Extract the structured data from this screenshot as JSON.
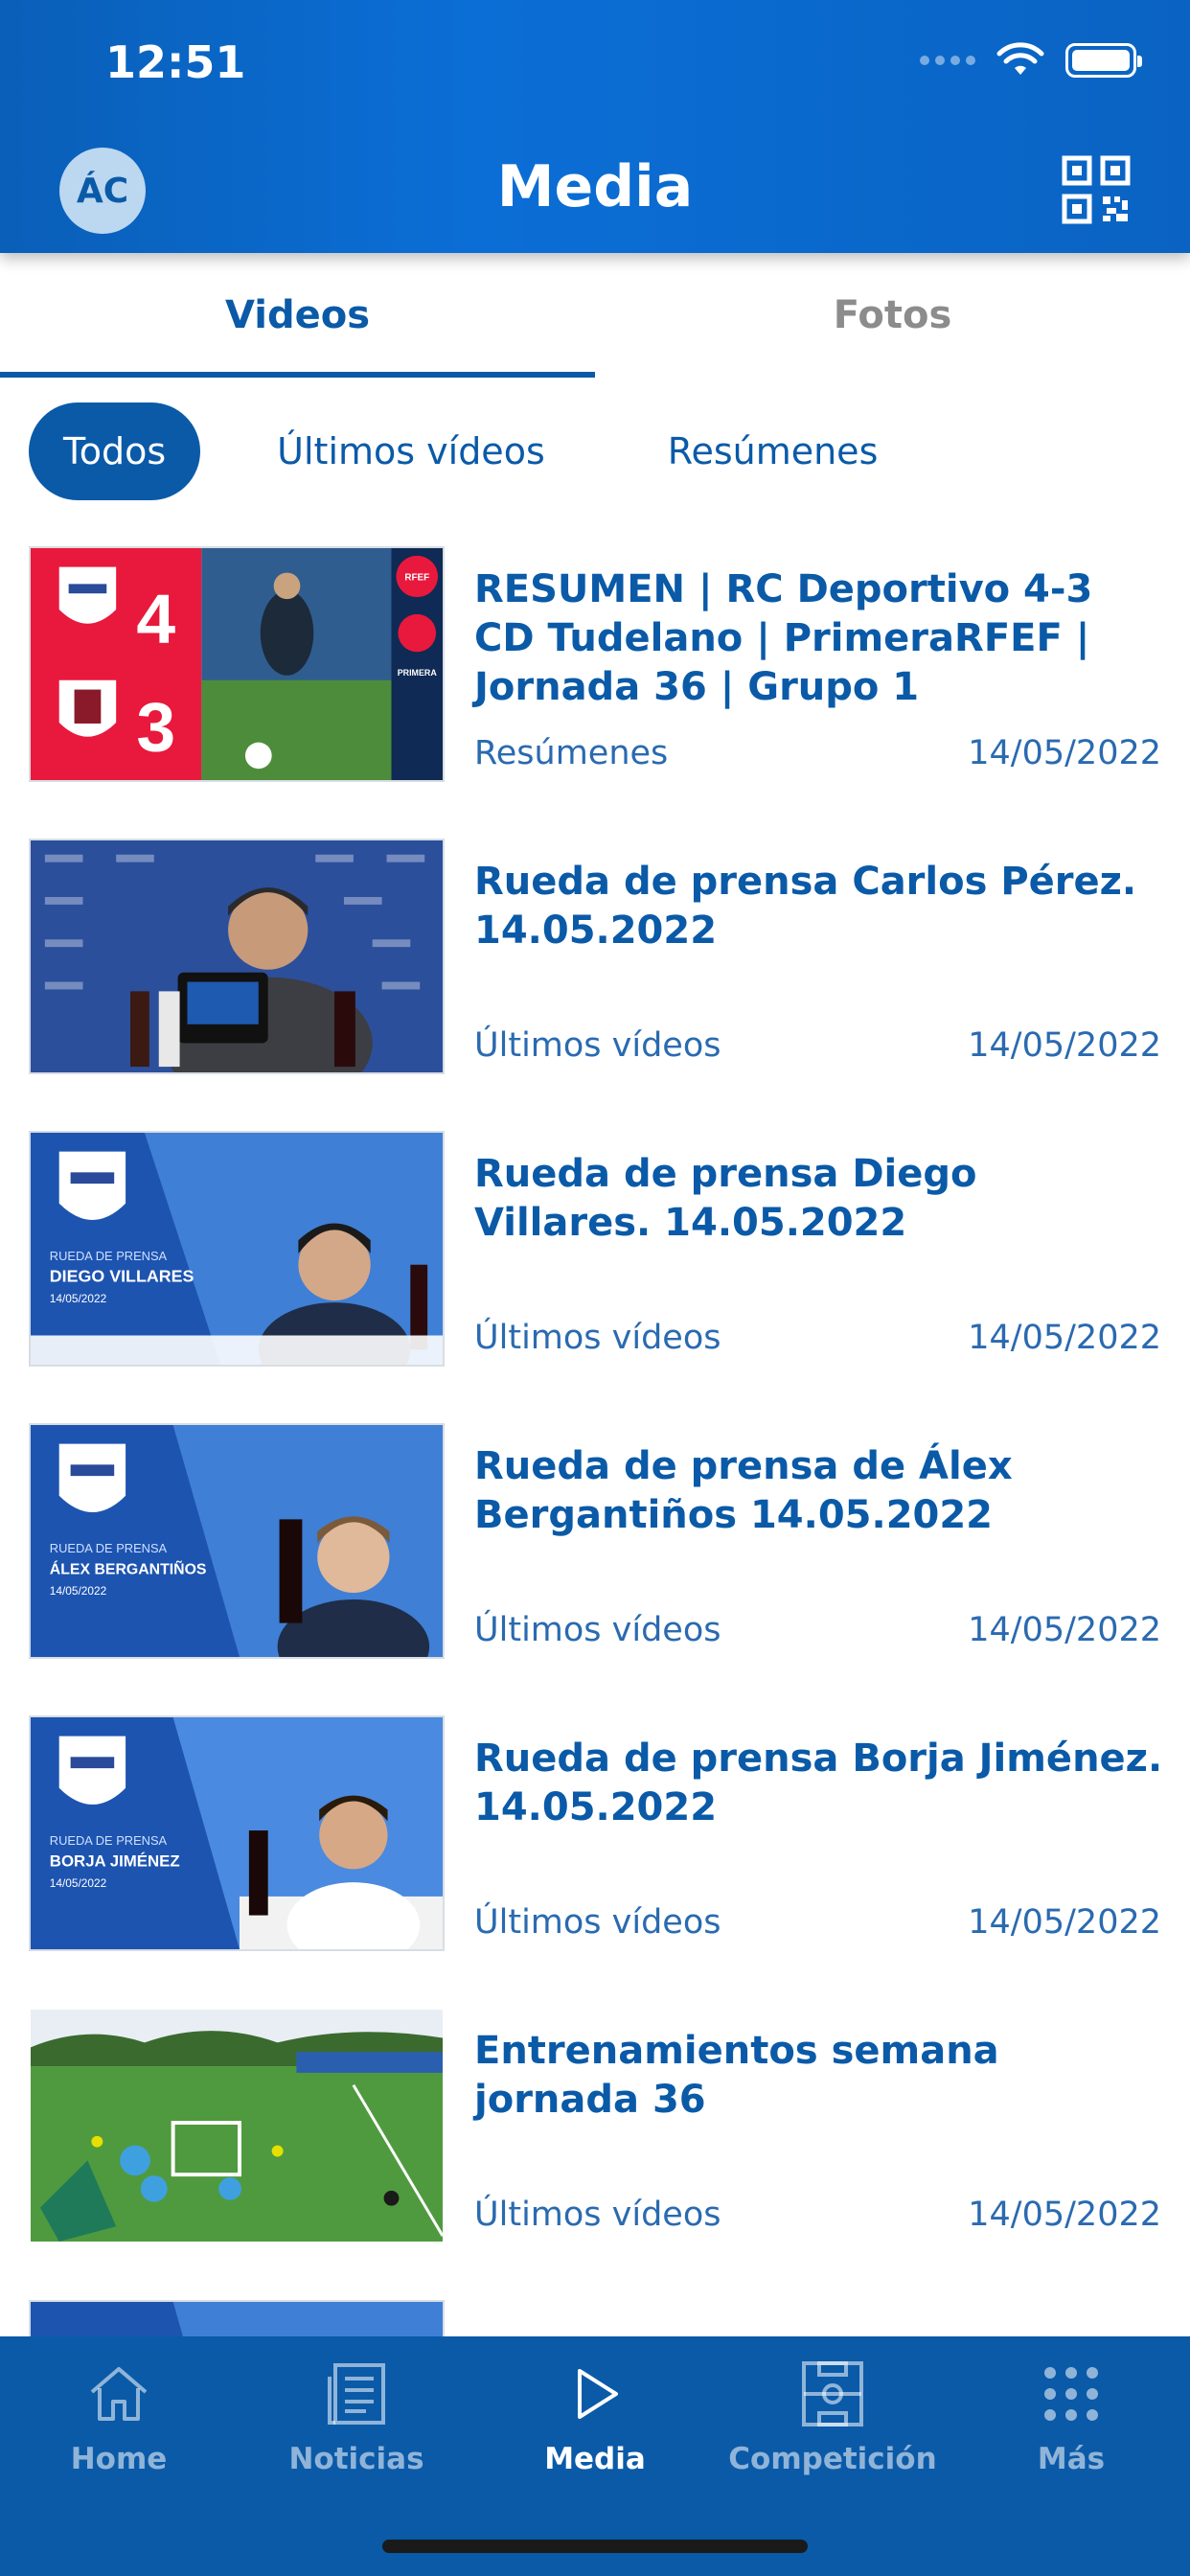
{
  "status_bar": {
    "time": "12:51"
  },
  "header": {
    "avatar_initials": "ÁC",
    "title": "Media"
  },
  "tabs": [
    {
      "label": "Videos",
      "active": true
    },
    {
      "label": "Fotos",
      "active": false
    }
  ],
  "filters": [
    {
      "label": "Todos",
      "active": true
    },
    {
      "label": "Últimos vídeos",
      "active": false
    },
    {
      "label": "Resúmenes",
      "active": false
    }
  ],
  "videos": [
    {
      "title": "RESUMEN | RC Deportivo 4-3 CD Tudelano | PrimeraRFEF | Jornada 36 | Grupo 1",
      "category": "Resúmenes",
      "date": "14/05/2022",
      "score_home": "4",
      "score_away": "3",
      "thumb_badge": "RFEF",
      "thumb_league": "PRIMERA"
    },
    {
      "title": "Rueda de prensa Carlos Pérez. 14.05.2022",
      "category": "Últimos vídeos",
      "date": "14/05/2022"
    },
    {
      "title": "Rueda de prensa Diego Villares. 14.05.2022",
      "category": "Últimos vídeos",
      "date": "14/05/2022",
      "thumb_caption": "RUEDA DE PRENSA",
      "thumb_name": "DIEGO VILLARES",
      "thumb_date": "14/05/2022"
    },
    {
      "title": "Rueda de prensa de Álex Bergantiños 14.05.2022",
      "category": "Últimos vídeos",
      "date": "14/05/2022",
      "thumb_caption": "RUEDA DE PRENSA",
      "thumb_name": "ÁLEX BERGANTIÑOS",
      "thumb_date": "14/05/2022"
    },
    {
      "title": "Rueda de prensa Borja Jiménez. 14.05.2022",
      "category": "Últimos vídeos",
      "date": "14/05/2022",
      "thumb_caption": "RUEDA DE PRENSA",
      "thumb_name": "BORJA JIMÉNEZ",
      "thumb_date": "14/05/2022"
    },
    {
      "title": "Entrenamientos semana jornada 36",
      "category": "Últimos vídeos",
      "date": "14/05/2022"
    }
  ],
  "bottom_nav": [
    {
      "label": "Home",
      "icon": "home-icon",
      "active": false
    },
    {
      "label": "Noticias",
      "icon": "news-icon",
      "active": false
    },
    {
      "label": "Media",
      "icon": "play-icon",
      "active": true
    },
    {
      "label": "Competición",
      "icon": "field-icon",
      "active": false
    },
    {
      "label": "Más",
      "icon": "more-dots-icon",
      "active": false
    }
  ],
  "colors": {
    "brand_blue": "#0a5aa8",
    "header_blue": "#0b6ed6",
    "red_panel": "#e8193c"
  }
}
